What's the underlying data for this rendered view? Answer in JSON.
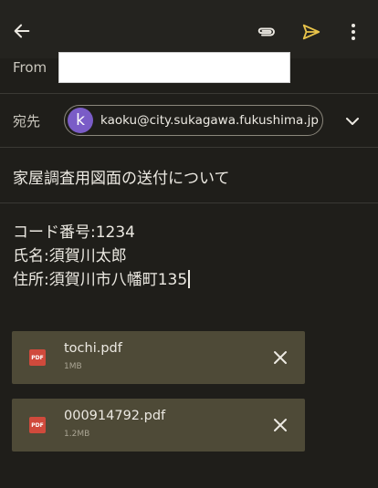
{
  "from": {
    "label": "From",
    "value": ""
  },
  "to": {
    "label": "宛先",
    "avatar_letter": "k",
    "email": "kaoku@city.sukagawa.fukushima.jp"
  },
  "subject": "家屋調査用図面の送付について",
  "body": {
    "lines": [
      "コード番号:1234",
      "氏名:須賀川太郎",
      "住所:須賀川市八幡町135"
    ]
  },
  "attachments": [
    {
      "icon_label": "PDF",
      "name": "tochi.pdf",
      "size": "1MB"
    },
    {
      "icon_label": "PDF",
      "name": "000914792.pdf",
      "size": "1.2MB"
    }
  ],
  "colors": {
    "background": "#1f1e1a",
    "send_icon": "#e8c34a",
    "avatar": "#7a5cc7",
    "attachment_bg": "#4e4a37",
    "pdf_icon": "#d04a3c"
  },
  "icons": [
    "back-arrow-icon",
    "attach-icon",
    "send-icon",
    "more-vert-icon",
    "chevron-down-icon",
    "pdf-icon",
    "close-icon"
  ]
}
